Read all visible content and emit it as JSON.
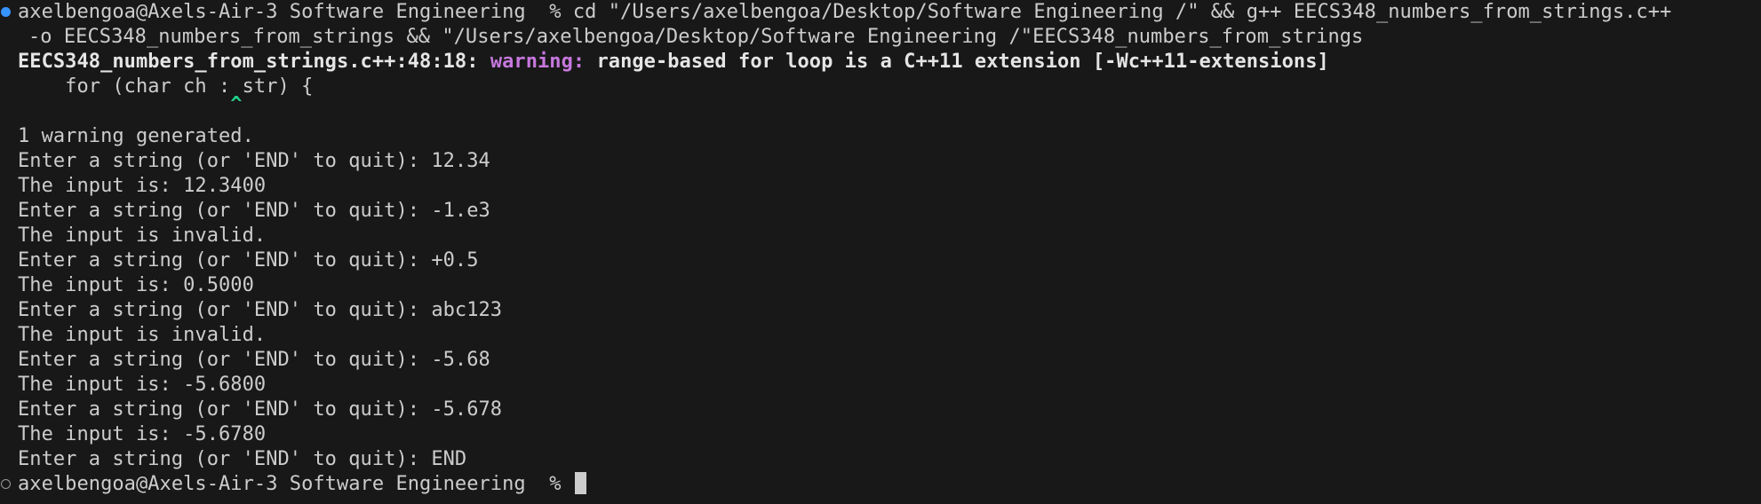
{
  "terminal": {
    "colors": {
      "background": "#181818",
      "text": "#cccccc",
      "warning": "#c678dd",
      "caret": "#23d18b",
      "dot_success": "#3794ff",
      "dot_idle": "#9a9a9a"
    },
    "command": {
      "prompt": "axelbengoa@Axels-Air-3 Software Engineering  % ",
      "text": "cd \"/Users/axelbengoa/Desktop/Software Engineering /\" && g++ EECS348_numbers_from_strings.c++",
      "continuation": "-o EECS348_numbers_from_strings && \"/Users/axelbengoa/Desktop/Software Engineering /\"EECS348_numbers_from_strings"
    },
    "compiler_warning": {
      "location": "EECS348_numbers_from_strings.c++:48:18: ",
      "label": "warning:",
      "message": " range-based for loop is a C++11 extension [-Wc++11-extensions]",
      "source_line": "    for (char ch : str) {",
      "caret_line": "                  ^",
      "summary": "1 warning generated."
    },
    "session": [
      "Enter a string (or 'END' to quit): 12.34",
      "The input is: 12.3400",
      "Enter a string (or 'END' to quit): -1.e3",
      "The input is invalid.",
      "Enter a string (or 'END' to quit): +0.5",
      "The input is: 0.5000",
      "Enter a string (or 'END' to quit): abc123",
      "The input is invalid.",
      "Enter a string (or 'END' to quit): -5.68",
      "The input is: -5.6800",
      "Enter a string (or 'END' to quit): -5.678",
      "The input is: -5.6780",
      "Enter a string (or 'END' to quit): END"
    ],
    "final_prompt": "axelbengoa@Axels-Air-3 Software Engineering  % "
  }
}
